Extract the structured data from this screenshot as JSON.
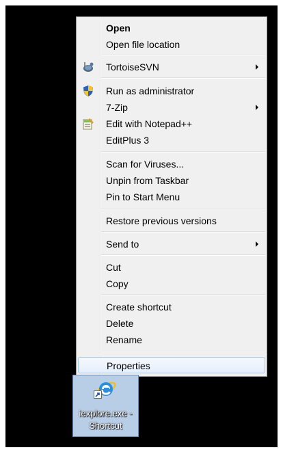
{
  "context_menu": {
    "items": [
      {
        "label": "Open"
      },
      {
        "label": "Open file location"
      },
      {
        "label": "TortoiseSVN",
        "icon": "tortoisesvn-icon"
      },
      {
        "label": "Run as administrator",
        "icon": "uac-shield-icon"
      },
      {
        "label": "7-Zip"
      },
      {
        "label": "Edit with Notepad++",
        "icon": "notepad-plus-plus-icon"
      },
      {
        "label": "EditPlus 3"
      },
      {
        "label": "Scan for Viruses..."
      },
      {
        "label": "Unpin from Taskbar"
      },
      {
        "label": "Pin to Start Menu"
      },
      {
        "label": "Restore previous versions"
      },
      {
        "label": "Send to"
      },
      {
        "label": "Cut"
      },
      {
        "label": "Copy"
      },
      {
        "label": "Create shortcut"
      },
      {
        "label": "Delete"
      },
      {
        "label": "Rename"
      },
      {
        "label": "Properties"
      }
    ]
  },
  "desktop_icon": {
    "line1": "iexplore.exe -",
    "line2": "Shortcut",
    "icon": "internet-explorer-icon"
  }
}
